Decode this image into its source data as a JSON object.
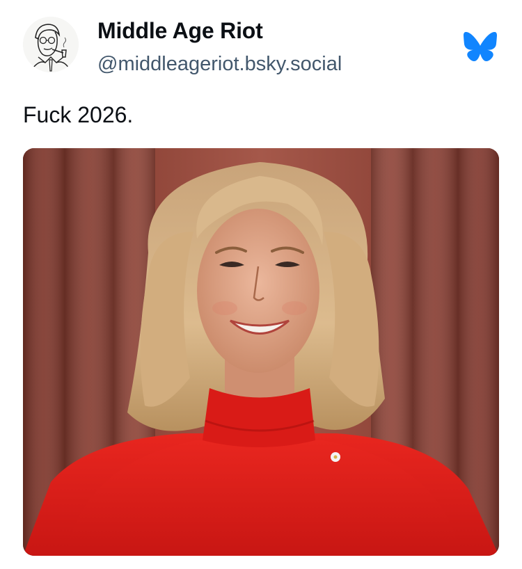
{
  "post": {
    "author": {
      "display_name": "Middle Age Riot",
      "handle": "@middleageriot.bsky.social",
      "avatar_icon": "vintage-man-smoking-pipe-drawing"
    },
    "platform_icon": "bluesky-butterfly-icon",
    "text": "Fuck 2026.",
    "media": {
      "description_icon": "photo-smiling-woman-red-turtleneck",
      "colors": {
        "curtain": "#9b4a3d",
        "sweater": "#e01f1c",
        "hair": "#d6b184",
        "skin": "#e2a98b"
      }
    }
  },
  "colors": {
    "text_primary": "#0b0f14",
    "text_secondary": "#42576c",
    "brand": "#1185fe"
  }
}
